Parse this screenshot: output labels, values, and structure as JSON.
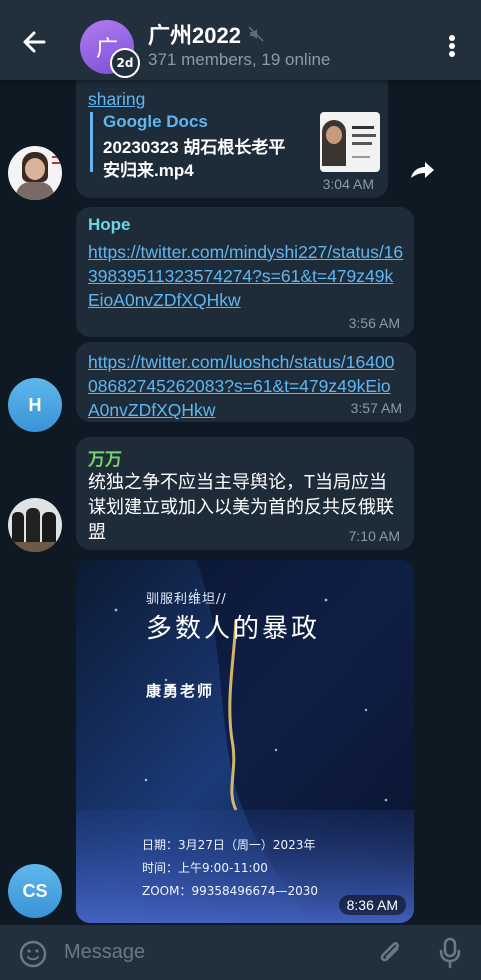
{
  "header": {
    "avatar_letter": "广",
    "story_badge": "2d",
    "title": "广州2022",
    "subtitle": "371 members, 19 online"
  },
  "messages": {
    "m1": {
      "link_tail": "sharing",
      "preview_site": "Google Docs",
      "preview_title": "20230323 胡石根长老平安归来.mp4",
      "time": "3:04 AM"
    },
    "m2": {
      "sender": "Hope",
      "link": "https://twitter.com/mindyshi227/status/1639839511323574274?s=61&t=479z49kEioA0nvZDfXQHkw",
      "time": "3:56 AM"
    },
    "m3": {
      "link": "https://twitter.com/luoshch/status/1640008682745262083?s=61&t=479z49kEioA0nvZDfXQHkw",
      "time": "3:57 AM",
      "avatar_letter": "H"
    },
    "m4": {
      "sender": "万万",
      "text": "统独之争不应当主导舆论，T当局应当谋划建立或加入以美为首的反共反俄联盟",
      "time": "7:10 AM"
    },
    "m5": {
      "poster_series": "驯服利维坦//",
      "poster_title": "多数人的暴政",
      "poster_teacher": "康勇老师",
      "poster_date": "日期：3月27日（周一）2023年",
      "poster_time": "时间：上午9:00-11:00",
      "poster_zoom": "ZOOM：99358496674—2030",
      "time": "8:36 AM",
      "avatar_letter": "CS"
    }
  },
  "input": {
    "placeholder": "Message"
  },
  "colors": {
    "header_bg": "#222f3d",
    "bubble_bg": "#1e2c3a",
    "link": "#5fb6f0",
    "sender_hope": "#6ed4e2",
    "sender_wanwan": "#78d46a",
    "google_docs": "#5fb6f0"
  }
}
